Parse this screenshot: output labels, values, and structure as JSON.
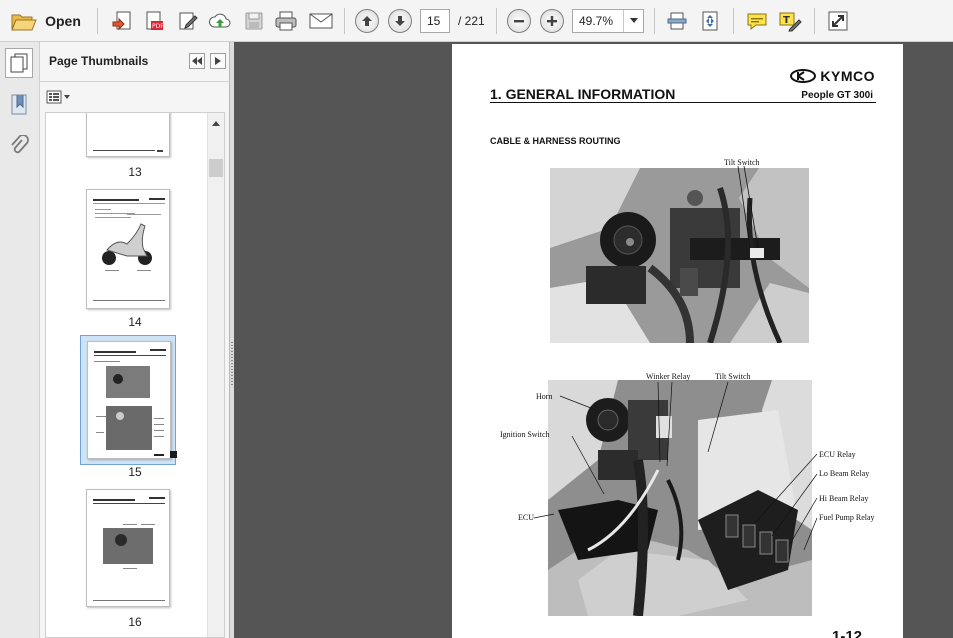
{
  "toolbar": {
    "open_label": "Open",
    "current_page": "15",
    "total_pages": "/ 221",
    "zoom": "49.7%"
  },
  "thumbnails_panel": {
    "title": "Page Thumbnails",
    "pages": [
      {
        "label": "13"
      },
      {
        "label": "14"
      },
      {
        "label": "15",
        "selected": true
      },
      {
        "label": "16"
      }
    ]
  },
  "document": {
    "brand": "KYMCO",
    "section_title": "1. GENERAL INFORMATION",
    "model": "People GT 300i",
    "subsection": "CABLE & HARNESS ROUTING",
    "photo1_callouts": {
      "tilt_switch": "Tilt Switch"
    },
    "photo2_callouts": {
      "winker_relay": "Winker Relay",
      "tilt_switch": "Tilt Switch",
      "horn": "Horn",
      "ignition_switch": "Ignition Switch",
      "ecu_relay": "ECU Relay",
      "lo_beam_relay": "Lo Beam Relay",
      "hi_beam_relay": "Hi Beam Relay",
      "fuel_pump_relay": "Fuel Pump Relay",
      "ecu": "ECU"
    },
    "page_number": "1-12"
  }
}
